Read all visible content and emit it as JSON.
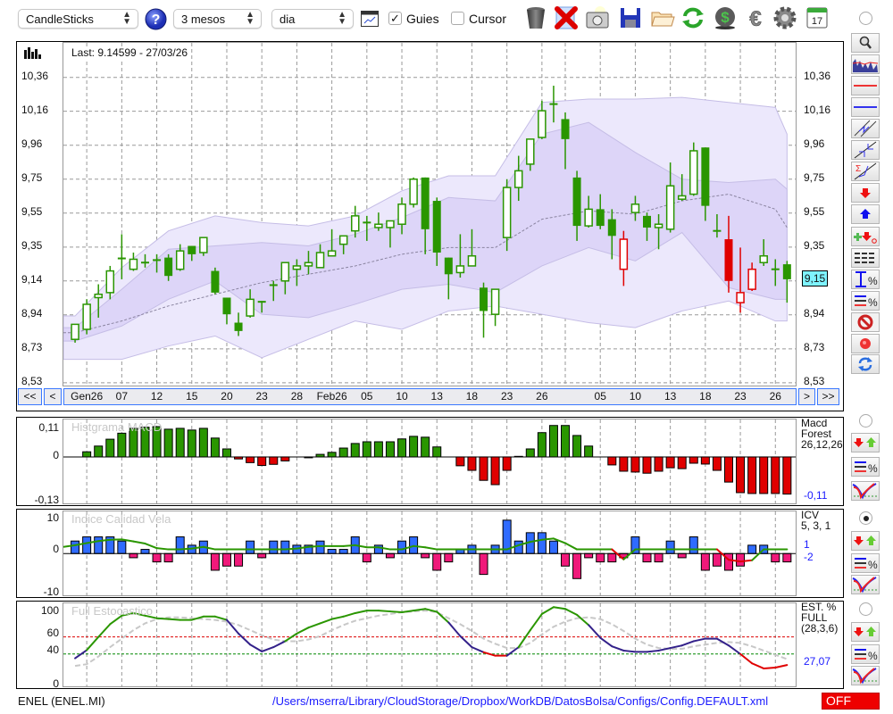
{
  "toolbar": {
    "chart_type": "CandleSticks",
    "period": "3 mesos",
    "interval": "dia",
    "guides_label": "Guies",
    "guides_checked": true,
    "cursor_label": "Cursor",
    "cursor_checked": false,
    "check_mark": "✓",
    "calendar_day": "17",
    "icons": [
      "help-icon",
      "chart-window-icon",
      "trash-icon",
      "delete-icon",
      "camera-icon",
      "save-icon",
      "open-folder-icon",
      "refresh-icon",
      "currency-dollar-icon",
      "euro-icon",
      "settings-gear-icon",
      "calendar-icon"
    ]
  },
  "main": {
    "last_label": "Last: 9.14599 - 27/03/26",
    "price_tag": "9,15",
    "nav": {
      "first": "<<",
      "prev": "<",
      "next": ">",
      "last": ">>"
    }
  },
  "panels": {
    "macd": {
      "title": "Histgrama MACD",
      "y_labels": [
        "0,11",
        "0",
        "-0,13"
      ],
      "right": [
        "Macd",
        "Forest",
        "26,12,26"
      ],
      "value": "-0,11"
    },
    "icv": {
      "title": "Indice Calidad Vela",
      "y_labels": [
        "10",
        "0",
        "-10"
      ],
      "right": [
        "ICV",
        "5, 3, 1"
      ],
      "value1": "1",
      "value2": "-2"
    },
    "stoch": {
      "title": "Full Estocastico",
      "y_labels": [
        "100",
        "60",
        "40",
        "0"
      ],
      "right": [
        "EST. %",
        "FULL",
        "(28,3,6)"
      ],
      "value": "27,07"
    }
  },
  "footer": {
    "symbol": "ENEL (ENEL.MI)",
    "path": "/Users/mserra/Library/CloudStorage/Dropbox/WorkDB/DatosBolsa/Configs/Config.DEFAULT.xml",
    "status": "OFF"
  },
  "colors": {
    "up": "#2a9600",
    "alert": "#e00000",
    "icv_pos": "#2f6bff",
    "icv_neg": "#f0197a",
    "navy": "#33218a",
    "band_outer": "#ece8fc",
    "band_inner": "#ddd5f8",
    "link": "#1a1aff",
    "price_tag": "#7ff3ff"
  },
  "chart_data": [
    {
      "type": "candlestick",
      "title": "ENEL (ENEL.MI)",
      "ylim": [
        8.513,
        10.567
      ],
      "y_ticks": [
        10.36,
        10.157,
        9.953,
        9.75,
        9.547,
        9.343,
        9.14,
        8.937,
        8.733,
        8.53
      ],
      "y_tick_labels": [
        "10,36",
        "10,16",
        "9,96",
        "9,75",
        "9,55",
        "9,35",
        "9,14",
        "8,94",
        "8,73",
        "8,53"
      ],
      "x_ticks": [
        {
          "idx": 1,
          "label": "Gen26"
        },
        {
          "idx": 4,
          "label": "07"
        },
        {
          "idx": 7,
          "label": "12"
        },
        {
          "idx": 10,
          "label": "15"
        },
        {
          "idx": 13,
          "label": "20"
        },
        {
          "idx": 16,
          "label": "23"
        },
        {
          "idx": 19,
          "label": "28"
        },
        {
          "idx": 22,
          "label": "Feb26"
        },
        {
          "idx": 25,
          "label": "05"
        },
        {
          "idx": 28,
          "label": "10"
        },
        {
          "idx": 31,
          "label": "13"
        },
        {
          "idx": 34,
          "label": "18"
        },
        {
          "idx": 37,
          "label": "23"
        },
        {
          "idx": 40,
          "label": "26"
        },
        {
          "idx": 42,
          "label": ""
        },
        {
          "idx": 45,
          "label": "05"
        },
        {
          "idx": 48,
          "label": "10"
        },
        {
          "idx": 51,
          "label": "13"
        },
        {
          "idx": 54,
          "label": "18"
        },
        {
          "idx": 57,
          "label": "23"
        },
        {
          "idx": 60,
          "label": "26"
        }
      ],
      "ohlc_fields": [
        "open",
        "high",
        "low",
        "close",
        "color"
      ],
      "candles": [
        [
          8.79,
          8.88,
          8.77,
          8.88,
          "g"
        ],
        [
          8.85,
          9.03,
          8.82,
          9.0,
          "g"
        ],
        [
          9.04,
          9.12,
          8.92,
          9.06,
          "g"
        ],
        [
          9.07,
          9.23,
          9.03,
          9.2,
          "g"
        ],
        [
          9.28,
          9.42,
          9.15,
          9.27,
          "g"
        ],
        [
          9.21,
          9.31,
          9.2,
          9.27,
          "g"
        ],
        [
          9.25,
          9.3,
          9.22,
          9.25,
          "g"
        ],
        [
          9.26,
          9.3,
          9.19,
          9.27,
          "g"
        ],
        [
          9.28,
          9.3,
          9.14,
          9.17,
          "g"
        ],
        [
          9.21,
          9.36,
          9.2,
          9.32,
          "g"
        ],
        [
          9.35,
          9.35,
          9.26,
          9.3,
          "g"
        ],
        [
          9.31,
          9.4,
          9.29,
          9.4,
          "g"
        ],
        [
          9.2,
          9.22,
          9.06,
          9.07,
          "g"
        ],
        [
          9.04,
          9.04,
          8.88,
          8.94,
          "g"
        ],
        [
          8.89,
          8.95,
          8.81,
          8.84,
          "g"
        ],
        [
          8.93,
          9.09,
          8.92,
          9.03,
          "g"
        ],
        [
          9.01,
          9.02,
          8.95,
          9.02,
          "g"
        ],
        [
          9.11,
          9.14,
          9.02,
          9.12,
          "g"
        ],
        [
          9.14,
          9.25,
          9.06,
          9.25,
          "g"
        ],
        [
          9.21,
          9.27,
          9.11,
          9.23,
          "g"
        ],
        [
          9.23,
          9.32,
          9.18,
          9.25,
          "g"
        ],
        [
          9.22,
          9.36,
          9.22,
          9.31,
          "g"
        ],
        [
          9.29,
          9.45,
          9.29,
          9.32,
          "g"
        ],
        [
          9.36,
          9.41,
          9.3,
          9.41,
          "g"
        ],
        [
          9.44,
          9.59,
          9.4,
          9.53,
          "g"
        ],
        [
          9.49,
          9.53,
          9.38,
          9.49,
          "g"
        ],
        [
          9.46,
          9.55,
          9.44,
          9.48,
          "g"
        ],
        [
          9.46,
          9.5,
          9.34,
          9.5,
          "g"
        ],
        [
          9.48,
          9.64,
          9.42,
          9.6,
          "g"
        ],
        [
          9.6,
          9.76,
          9.58,
          9.75,
          "g"
        ],
        [
          9.76,
          9.76,
          9.3,
          9.45,
          "g"
        ],
        [
          9.62,
          9.64,
          9.23,
          9.31,
          "g"
        ],
        [
          9.28,
          9.28,
          9.03,
          9.18,
          "g"
        ],
        [
          9.19,
          9.42,
          9.16,
          9.23,
          "g"
        ],
        [
          9.23,
          9.45,
          9.23,
          9.29,
          "g"
        ],
        [
          9.1,
          9.13,
          8.8,
          8.96,
          "g"
        ],
        [
          8.94,
          9.09,
          8.87,
          9.09,
          "g"
        ],
        [
          9.4,
          9.75,
          9.32,
          9.7,
          "g"
        ],
        [
          9.7,
          9.89,
          9.62,
          9.8,
          "g"
        ],
        [
          9.84,
          9.99,
          9.8,
          9.99,
          "g"
        ],
        [
          10.0,
          10.22,
          9.99,
          10.16,
          "g"
        ],
        [
          10.2,
          10.31,
          10.09,
          10.2,
          "g"
        ],
        [
          10.11,
          10.15,
          9.81,
          9.99,
          "g"
        ],
        [
          9.76,
          9.8,
          9.38,
          9.47,
          "g"
        ],
        [
          9.47,
          9.65,
          9.46,
          9.57,
          "g"
        ],
        [
          9.57,
          9.66,
          9.45,
          9.47,
          "g"
        ],
        [
          9.51,
          9.57,
          9.27,
          9.41,
          "g"
        ],
        [
          9.21,
          9.44,
          9.11,
          9.39,
          "r"
        ],
        [
          9.55,
          9.65,
          9.5,
          9.6,
          "g"
        ],
        [
          9.53,
          9.55,
          9.38,
          9.46,
          "g"
        ],
        [
          9.46,
          9.54,
          9.33,
          9.48,
          "g"
        ],
        [
          9.45,
          9.85,
          9.43,
          9.71,
          "g"
        ],
        [
          9.63,
          9.78,
          9.62,
          9.65,
          "g"
        ],
        [
          9.66,
          9.97,
          9.65,
          9.92,
          "g"
        ],
        [
          9.94,
          9.94,
          9.5,
          9.59,
          "g"
        ],
        [
          9.44,
          9.54,
          9.4,
          9.44,
          "g"
        ],
        [
          9.39,
          9.53,
          9.07,
          9.14,
          "r"
        ],
        [
          9.01,
          9.34,
          8.95,
          9.07,
          "r"
        ],
        [
          9.09,
          9.25,
          9.08,
          9.21,
          "r"
        ],
        [
          9.25,
          9.39,
          9.23,
          9.29,
          "g"
        ],
        [
          9.21,
          9.27,
          9.11,
          9.21,
          "g"
        ],
        [
          9.24,
          9.26,
          9.01,
          9.15,
          "g"
        ]
      ],
      "bollinger": {
        "anchor_idx": [
          0,
          4,
          8,
          12,
          16,
          20,
          24,
          28,
          32,
          36,
          40,
          44,
          48,
          52,
          56,
          60,
          61
        ],
        "upper_outer": [
          8.93,
          9.22,
          9.44,
          9.53,
          9.49,
          9.47,
          9.53,
          9.68,
          9.77,
          9.77,
          10.21,
          10.23,
          10.23,
          10.24,
          10.21,
          10.18,
          10.02
        ],
        "upper_inner": [
          8.86,
          9.09,
          9.33,
          9.35,
          9.37,
          9.35,
          9.42,
          9.52,
          9.64,
          9.62,
          10.02,
          10.09,
          9.91,
          9.75,
          9.73,
          9.75,
          9.69
        ],
        "middle": [
          8.83,
          8.9,
          8.99,
          9.06,
          9.13,
          9.18,
          9.23,
          9.3,
          9.34,
          9.34,
          9.51,
          9.56,
          9.54,
          9.62,
          9.66,
          9.57,
          9.46
        ],
        "lower_inner": [
          8.78,
          8.87,
          9.03,
          9.14,
          8.94,
          8.92,
          9.0,
          9.09,
          9.12,
          9.07,
          9.23,
          9.34,
          9.26,
          9.43,
          9.1,
          9.03,
          9.03
        ],
        "lower_outer": [
          8.67,
          8.67,
          8.75,
          8.81,
          8.68,
          8.79,
          8.9,
          8.85,
          8.96,
          8.99,
          8.94,
          8.89,
          8.86,
          8.96,
          9.02,
          8.9,
          8.9
        ]
      },
      "last_price": 9.15
    },
    {
      "type": "bar",
      "title": "Histgrama MACD",
      "ylim": [
        -0.1625,
        0.131
      ],
      "values": [
        0,
        0.018,
        0.038,
        0.062,
        0.083,
        0.1,
        0.104,
        0.106,
        0.097,
        0.1,
        0.094,
        0.1,
        0.066,
        0.028,
        -0.007,
        -0.02,
        -0.03,
        -0.026,
        -0.014,
        0,
        -0.003,
        0.009,
        0.016,
        0.031,
        0.047,
        0.053,
        0.053,
        0.053,
        0.063,
        0.072,
        0.069,
        0.035,
        0,
        -0.031,
        -0.047,
        -0.082,
        -0.097,
        -0.047,
        0.002,
        0.028,
        0.085,
        0.11,
        0.11,
        0.075,
        0.038,
        0,
        -0.028,
        -0.05,
        -0.053,
        -0.057,
        -0.05,
        -0.038,
        -0.041,
        -0.022,
        -0.025,
        -0.047,
        -0.088,
        -0.125,
        -0.128,
        -0.128,
        -0.128,
        -0.13
      ]
    },
    {
      "type": "bar",
      "title": "Indice Calidad Vela",
      "ylim": [
        -10,
        10.1
      ],
      "values": [
        3,
        4,
        4,
        4,
        3,
        -1,
        1,
        -2,
        -2,
        4,
        2,
        3,
        -4,
        -3,
        -3,
        3,
        -1,
        3,
        3,
        2,
        2,
        3,
        1,
        1,
        4,
        -2,
        2,
        -1,
        3,
        4,
        -1,
        -4,
        -2,
        1,
        2,
        -5,
        2,
        8,
        3,
        5,
        5,
        3,
        -3,
        -6,
        -1,
        -2,
        -2,
        -1,
        4,
        -2,
        -2,
        3,
        -1,
        4,
        -4,
        -3,
        -4,
        -3,
        2,
        2,
        -2,
        -2
      ],
      "signal": [
        2.0,
        2.5,
        3.0,
        3.3,
        3.4,
        2.9,
        2.4,
        1.3,
        1.0,
        1.0,
        1.2,
        1.6,
        1.0,
        1.0,
        1.0,
        1.0,
        1.0,
        1.0,
        1.0,
        1.2,
        1.6,
        1.8,
        1.8,
        1.8,
        2.0,
        1.5,
        1.5,
        1.0,
        1.0,
        1.8,
        1.5,
        1.0,
        1.0,
        1.0,
        1.0,
        1.0,
        1.0,
        1.0,
        2.0,
        2.8,
        3.3,
        3.6,
        2.5,
        1.0,
        1.0,
        1.0,
        1.0,
        -1.4,
        1.0,
        1.0,
        1.0,
        1.0,
        1.0,
        1.0,
        1.0,
        1.0,
        -1.5,
        -1.9,
        -1.6,
        1.0,
        1.0,
        1.0
      ]
    },
    {
      "type": "line",
      "title": "Full Estocastico",
      "ylim": [
        2,
        99.5
      ],
      "levels": [
        60,
        40
      ],
      "main": [
        35,
        44.5,
        60,
        75,
        85,
        88,
        85,
        82,
        81,
        80,
        80,
        84,
        84,
        80,
        64,
        51,
        43,
        48,
        55,
        64,
        71,
        76,
        81,
        84,
        88,
        91,
        91,
        90,
        89,
        91,
        93,
        89.5,
        77,
        61,
        48,
        42,
        38,
        38,
        48,
        68,
        87,
        95,
        93,
        86,
        74,
        59,
        49,
        44,
        42.5,
        42.5,
        44,
        47,
        50,
        55,
        58,
        58,
        50,
        40,
        29,
        23,
        24,
        27.07
      ],
      "main_segment_colors": "nggggggggggggnnnnnggggggggggggggnnnrrnggggggnnnnnnnnnnnnnrrrr",
      "signal": [
        26,
        28,
        37,
        48,
        58,
        68,
        76,
        81,
        83,
        83,
        82,
        81,
        80,
        78,
        74,
        68,
        62,
        57,
        55,
        55,
        57,
        61,
        68,
        74,
        79,
        82,
        85,
        87,
        89,
        90,
        91,
        89,
        82,
        75,
        67,
        58,
        52,
        47,
        47,
        53,
        63,
        72,
        78,
        82,
        83,
        81,
        75,
        67,
        58,
        51,
        47,
        46,
        46,
        49,
        51,
        53,
        54,
        53,
        49,
        44,
        39,
        34
      ]
    }
  ]
}
